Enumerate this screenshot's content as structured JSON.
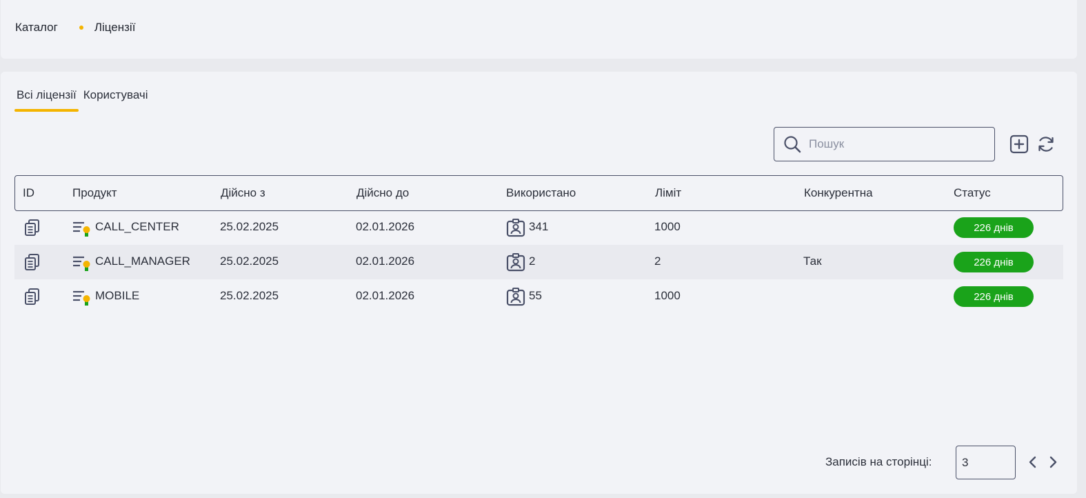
{
  "breadcrumb": {
    "items": [
      "Каталог",
      "Ліцензії"
    ]
  },
  "tabs": [
    {
      "label": "Всі ліцензії",
      "active": true
    },
    {
      "label": "Користувачі",
      "active": false
    }
  ],
  "search": {
    "placeholder": "Пошук",
    "value": ""
  },
  "toolbar": {
    "add_icon": "plus-square-icon",
    "refresh_icon": "refresh-icon"
  },
  "table": {
    "columns": [
      "ID",
      "Продукт",
      "Дійсно з",
      "Дійсно до",
      "Використано",
      "Ліміт",
      "Конкурентна",
      "Статус"
    ],
    "rows": [
      {
        "product": "CALL_CENTER",
        "valid_from": "25.02.2025",
        "valid_to": "02.01.2026",
        "used": "341",
        "limit": "1000",
        "concurrent": "",
        "status": "226 днів"
      },
      {
        "product": "CALL_MANAGER",
        "valid_from": "25.02.2025",
        "valid_to": "02.01.2026",
        "used": "2",
        "limit": "2",
        "concurrent": "Так",
        "status": "226 днів"
      },
      {
        "product": "MOBILE",
        "valid_from": "25.02.2025",
        "valid_to": "02.01.2026",
        "used": "55",
        "limit": "1000",
        "concurrent": "",
        "status": "226 днів"
      }
    ]
  },
  "pagination": {
    "label": "Записів на сторінці:",
    "per_page": "3"
  },
  "colors": {
    "accent": "#f4b400",
    "status_ok": "#1aa31a",
    "border": "#4a5068"
  }
}
